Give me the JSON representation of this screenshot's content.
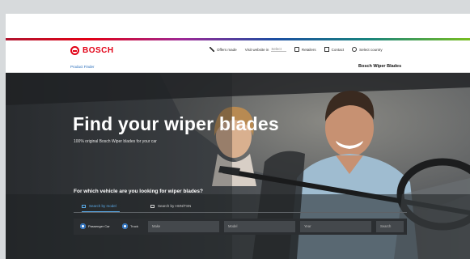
{
  "header": {
    "brand": "BOSCH",
    "nav": [
      {
        "icon": "pencil-icon",
        "label": "Offers made"
      },
      {
        "label": "Visit website in",
        "select_value": "Select"
      },
      {
        "icon": "people-icon",
        "label": "Retailers"
      },
      {
        "icon": "mail-icon",
        "label": "Contact"
      },
      {
        "icon": "globe-icon",
        "label": "Select country"
      }
    ]
  },
  "subnav": {
    "link": "Product Finder",
    "title": "Bosch Wiper Blades"
  },
  "hero": {
    "title": "Find your wiper blades",
    "subtitle": "100% original Bosch Wiper blades for your car"
  },
  "finder": {
    "question": "For which vehicle are you looking for wiper blades?",
    "tabs": [
      {
        "icon": "car-icon",
        "label": "Search by model",
        "active": true
      },
      {
        "icon": "document-icon",
        "label": "Search by HSN/TSN",
        "active": false
      }
    ],
    "vehicle_types": [
      {
        "label": "Passenger Car",
        "selected": true
      },
      {
        "label": "Truck",
        "selected": false
      }
    ],
    "fields": [
      {
        "placeholder": "Make"
      },
      {
        "placeholder": "Model"
      },
      {
        "placeholder": "Year"
      },
      {
        "placeholder": "Search"
      }
    ]
  },
  "colors": {
    "brand_red": "#e20015",
    "link_blue": "#2a6ebb",
    "accent_blue": "#5aa9e6",
    "hero_dark": "#2b2e31"
  }
}
